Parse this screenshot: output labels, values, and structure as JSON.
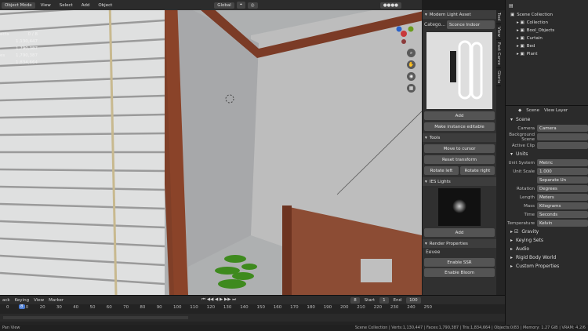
{
  "header": {
    "mode": "Object Mode",
    "menus": [
      "View",
      "Select",
      "Add",
      "Object"
    ],
    "orientation": "Global"
  },
  "stats": [
    {
      "l": "ects",
      "v": "0 / 8"
    },
    {
      "l": "",
      "v": "1,130,447"
    },
    {
      "l": "",
      "v": "1,790,387"
    },
    {
      "l": "es",
      "v": "1,790,387"
    },
    {
      "l": "",
      "v": "1,834,664"
    }
  ],
  "nav": {
    "axis_x": "X",
    "axis_y": "Y",
    "axis_z": "Z"
  },
  "npanel": {
    "title": "Modern Light Asset",
    "cat_label": "Catego...",
    "cat_value": "Sconce Indoor",
    "add": "Add",
    "make_editable": "Make instance editable",
    "tools_title": "Tools",
    "move_cursor": "Move to cursor",
    "reset": "Reset transform",
    "rot_left": "Rotate left",
    "rot_right": "Rotate right",
    "ies_title": "IES Lights",
    "ies_add": "Add",
    "render_title": "Render Properties",
    "engine": "Eevee",
    "ssr": "Enable SSR",
    "bloom": "Enable Bloom"
  },
  "vtabs": [
    "Tool",
    "View",
    "Fast Carve",
    "Gloria"
  ],
  "outliner": {
    "title": "Scene Collection",
    "items": [
      "Collection",
      "Bool_Objects",
      "Curtain",
      "Bed",
      "Plant"
    ]
  },
  "props": {
    "scene_label": "Scene",
    "view_layer": "View Layer",
    "section": "Scene",
    "rows": [
      {
        "l": "Camera",
        "v": "Camera"
      },
      {
        "l": "Background Scene",
        "v": ""
      },
      {
        "l": "Active Clip",
        "v": ""
      }
    ],
    "units_title": "Units",
    "units": [
      {
        "l": "Unit System",
        "v": "Metric"
      },
      {
        "l": "Unit Scale",
        "v": "1.000"
      },
      {
        "l": "",
        "v": "Separate Un"
      },
      {
        "l": "Rotation",
        "v": "Degrees"
      },
      {
        "l": "Length",
        "v": "Meters"
      },
      {
        "l": "Mass",
        "v": "Kilograms"
      },
      {
        "l": "Time",
        "v": "Seconds"
      },
      {
        "l": "Temperature",
        "v": "Kelvin"
      }
    ],
    "subs": [
      "Gravity",
      "Keying Sets",
      "Audio",
      "Rigid Body World",
      "Custom Properties"
    ]
  },
  "timeline": {
    "menus": [
      "ack",
      "Keying",
      "View",
      "Marker"
    ],
    "frame": "8",
    "start_label": "Start",
    "start": "1",
    "end_label": "End",
    "end": "100",
    "ticks": [
      "0",
      "10",
      "20",
      "30",
      "40",
      "50",
      "60",
      "70",
      "80",
      "90",
      "100",
      "110",
      "120",
      "130",
      "140",
      "150",
      "160",
      "170",
      "180",
      "190",
      "200",
      "210",
      "220",
      "230",
      "240",
      "250"
    ],
    "current": "8"
  },
  "status": {
    "left": "Pan View",
    "right": "Scene Collection | Verts:1,130,447 | Faces:1,790,387 | Tris:1,834,664 | Objects:0/83 | Memory: 1.27 GiB | VRAM: 4.2/6"
  },
  "colors": {
    "wood": "#7b3b26",
    "wall": "#b5b6b8"
  }
}
